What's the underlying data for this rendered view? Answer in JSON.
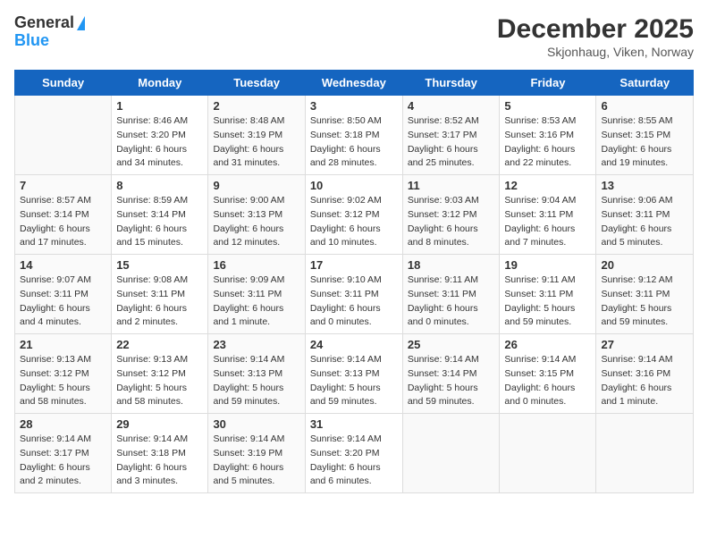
{
  "logo": {
    "general": "General",
    "blue": "Blue"
  },
  "title": "December 2025",
  "subtitle": "Skjonhaug, Viken, Norway",
  "days_of_week": [
    "Sunday",
    "Monday",
    "Tuesday",
    "Wednesday",
    "Thursday",
    "Friday",
    "Saturday"
  ],
  "weeks": [
    [
      {
        "day": null,
        "info": null
      },
      {
        "day": "1",
        "sunrise": "8:46 AM",
        "sunset": "3:20 PM",
        "daylight": "6 hours and 34 minutes."
      },
      {
        "day": "2",
        "sunrise": "8:48 AM",
        "sunset": "3:19 PM",
        "daylight": "6 hours and 31 minutes."
      },
      {
        "day": "3",
        "sunrise": "8:50 AM",
        "sunset": "3:18 PM",
        "daylight": "6 hours and 28 minutes."
      },
      {
        "day": "4",
        "sunrise": "8:52 AM",
        "sunset": "3:17 PM",
        "daylight": "6 hours and 25 minutes."
      },
      {
        "day": "5",
        "sunrise": "8:53 AM",
        "sunset": "3:16 PM",
        "daylight": "6 hours and 22 minutes."
      },
      {
        "day": "6",
        "sunrise": "8:55 AM",
        "sunset": "3:15 PM",
        "daylight": "6 hours and 19 minutes."
      }
    ],
    [
      {
        "day": "7",
        "sunrise": "8:57 AM",
        "sunset": "3:14 PM",
        "daylight": "6 hours and 17 minutes."
      },
      {
        "day": "8",
        "sunrise": "8:59 AM",
        "sunset": "3:14 PM",
        "daylight": "6 hours and 15 minutes."
      },
      {
        "day": "9",
        "sunrise": "9:00 AM",
        "sunset": "3:13 PM",
        "daylight": "6 hours and 12 minutes."
      },
      {
        "day": "10",
        "sunrise": "9:02 AM",
        "sunset": "3:12 PM",
        "daylight": "6 hours and 10 minutes."
      },
      {
        "day": "11",
        "sunrise": "9:03 AM",
        "sunset": "3:12 PM",
        "daylight": "6 hours and 8 minutes."
      },
      {
        "day": "12",
        "sunrise": "9:04 AM",
        "sunset": "3:11 PM",
        "daylight": "6 hours and 7 minutes."
      },
      {
        "day": "13",
        "sunrise": "9:06 AM",
        "sunset": "3:11 PM",
        "daylight": "6 hours and 5 minutes."
      }
    ],
    [
      {
        "day": "14",
        "sunrise": "9:07 AM",
        "sunset": "3:11 PM",
        "daylight": "6 hours and 4 minutes."
      },
      {
        "day": "15",
        "sunrise": "9:08 AM",
        "sunset": "3:11 PM",
        "daylight": "6 hours and 2 minutes."
      },
      {
        "day": "16",
        "sunrise": "9:09 AM",
        "sunset": "3:11 PM",
        "daylight": "6 hours and 1 minute."
      },
      {
        "day": "17",
        "sunrise": "9:10 AM",
        "sunset": "3:11 PM",
        "daylight": "6 hours and 0 minutes."
      },
      {
        "day": "18",
        "sunrise": "9:11 AM",
        "sunset": "3:11 PM",
        "daylight": "6 hours and 0 minutes."
      },
      {
        "day": "19",
        "sunrise": "9:11 AM",
        "sunset": "3:11 PM",
        "daylight": "5 hours and 59 minutes."
      },
      {
        "day": "20",
        "sunrise": "9:12 AM",
        "sunset": "3:11 PM",
        "daylight": "5 hours and 59 minutes."
      }
    ],
    [
      {
        "day": "21",
        "sunrise": "9:13 AM",
        "sunset": "3:12 PM",
        "daylight": "5 hours and 58 minutes."
      },
      {
        "day": "22",
        "sunrise": "9:13 AM",
        "sunset": "3:12 PM",
        "daylight": "5 hours and 58 minutes."
      },
      {
        "day": "23",
        "sunrise": "9:14 AM",
        "sunset": "3:13 PM",
        "daylight": "5 hours and 59 minutes."
      },
      {
        "day": "24",
        "sunrise": "9:14 AM",
        "sunset": "3:13 PM",
        "daylight": "5 hours and 59 minutes."
      },
      {
        "day": "25",
        "sunrise": "9:14 AM",
        "sunset": "3:14 PM",
        "daylight": "5 hours and 59 minutes."
      },
      {
        "day": "26",
        "sunrise": "9:14 AM",
        "sunset": "3:15 PM",
        "daylight": "6 hours and 0 minutes."
      },
      {
        "day": "27",
        "sunrise": "9:14 AM",
        "sunset": "3:16 PM",
        "daylight": "6 hours and 1 minute."
      }
    ],
    [
      {
        "day": "28",
        "sunrise": "9:14 AM",
        "sunset": "3:17 PM",
        "daylight": "6 hours and 2 minutes."
      },
      {
        "day": "29",
        "sunrise": "9:14 AM",
        "sunset": "3:18 PM",
        "daylight": "6 hours and 3 minutes."
      },
      {
        "day": "30",
        "sunrise": "9:14 AM",
        "sunset": "3:19 PM",
        "daylight": "6 hours and 5 minutes."
      },
      {
        "day": "31",
        "sunrise": "9:14 AM",
        "sunset": "3:20 PM",
        "daylight": "6 hours and 6 minutes."
      },
      {
        "day": null,
        "info": null
      },
      {
        "day": null,
        "info": null
      },
      {
        "day": null,
        "info": null
      }
    ]
  ],
  "labels": {
    "sunrise": "Sunrise:",
    "sunset": "Sunset:",
    "daylight": "Daylight:"
  }
}
